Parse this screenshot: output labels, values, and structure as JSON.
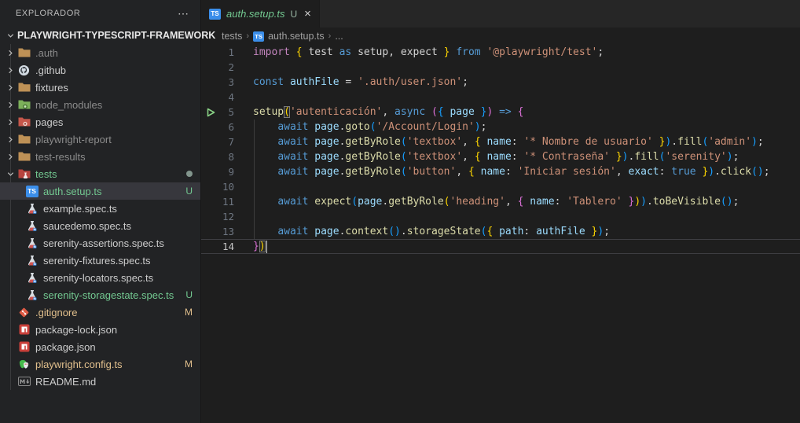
{
  "colors": {
    "accent_green_untracked": "#73c991",
    "accent_tan_modified": "#e2c08d",
    "ts_icon_blue": "#3b8eea",
    "folder_tan": "#be9156",
    "folder_node_green": "#7cb05a",
    "folder_pages_red": "#c6574b",
    "folder_tests_red": "#b7443e",
    "npm_red": "#cb3837",
    "git_orange": "#de4c36",
    "bracket_gold": "#ffd700",
    "bracket_pink": "#da70d6",
    "bracket_blue": "#179fff",
    "string_orange": "#ce9178",
    "keyword_blue": "#569cd6",
    "keyword_pink": "#c586c0",
    "function_yellow": "#dcdcaa",
    "identifier_blue": "#9cdcfe"
  },
  "sidebar": {
    "title": "EXPLORADOR",
    "more_actions": "⋯",
    "root": {
      "label": "PLAYWRIGHT-TYPESCRIPT-FRAMEWORK",
      "chevron": "down"
    },
    "items": [
      {
        "label": ".auth",
        "icon": "folder",
        "chevron": "right",
        "dim": true,
        "indent": 1
      },
      {
        "label": ".github",
        "icon": "github",
        "chevron": "right",
        "indent": 1
      },
      {
        "label": "fixtures",
        "icon": "folder",
        "chevron": "right",
        "indent": 1
      },
      {
        "label": "node_modules",
        "icon": "folder-node",
        "chevron": "right",
        "dim": true,
        "indent": 1
      },
      {
        "label": "pages",
        "icon": "folder-pages",
        "chevron": "right",
        "indent": 1
      },
      {
        "label": "playwright-report",
        "icon": "folder",
        "chevron": "right",
        "dim": true,
        "indent": 1
      },
      {
        "label": "test-results",
        "icon": "folder",
        "chevron": "right",
        "dim": true,
        "indent": 1
      },
      {
        "label": "tests",
        "icon": "folder-tests",
        "chevron": "down",
        "color": "green",
        "badge": "dot",
        "indent": 1
      },
      {
        "label": "auth.setup.ts",
        "icon": "ts",
        "indent": 2,
        "selected": true,
        "color": "green",
        "badge": "U"
      },
      {
        "label": "example.spec.ts",
        "icon": "flask",
        "indent": 2
      },
      {
        "label": "saucedemo.spec.ts",
        "icon": "flask",
        "indent": 2
      },
      {
        "label": "serenity-assertions.spec.ts",
        "icon": "flask",
        "indent": 2
      },
      {
        "label": "serenity-fixtures.spec.ts",
        "icon": "flask",
        "indent": 2
      },
      {
        "label": "serenity-locators.spec.ts",
        "icon": "flask",
        "indent": 2
      },
      {
        "label": "serenity-storagestate.spec.ts",
        "icon": "flask",
        "indent": 2,
        "color": "green",
        "badge": "U"
      },
      {
        "label": ".gitignore",
        "icon": "git",
        "indent": 1,
        "file": true,
        "color": "mod",
        "badge": "M"
      },
      {
        "label": "package-lock.json",
        "icon": "npm",
        "indent": 1,
        "file": true
      },
      {
        "label": "package.json",
        "icon": "npm",
        "indent": 1,
        "file": true
      },
      {
        "label": "playwright.config.ts",
        "icon": "playwright",
        "indent": 1,
        "file": true,
        "color": "mod",
        "badge": "M"
      },
      {
        "label": "README.md",
        "icon": "markdown",
        "indent": 1,
        "file": true
      }
    ]
  },
  "tabbar": {
    "tab": {
      "label": "auth.setup.ts",
      "badge": "U",
      "close": "×",
      "modified_state": "untracked",
      "preview_italic": true
    }
  },
  "breadcrumbs": {
    "items": [
      "tests",
      "auth.setup.ts",
      "..."
    ]
  },
  "editor": {
    "language": "typescript",
    "current_line": 14,
    "lines": [
      {
        "n": 1,
        "tokens": [
          [
            "import",
            "kp"
          ],
          [
            " ",
            "pl"
          ],
          [
            "{",
            "b1"
          ],
          [
            " ",
            "pl"
          ],
          [
            "test",
            "pl"
          ],
          [
            " ",
            "pl"
          ],
          [
            "as",
            "kb"
          ],
          [
            " ",
            "pl"
          ],
          [
            "setup",
            "pl"
          ],
          [
            ", ",
            "pl"
          ],
          [
            "expect",
            "pl"
          ],
          [
            " ",
            "pl"
          ],
          [
            "}",
            "b1"
          ],
          [
            " ",
            "pl"
          ],
          [
            "from",
            "kb"
          ],
          [
            " ",
            "pl"
          ],
          [
            "'@playwright/test'",
            "st"
          ],
          [
            ";",
            "pl"
          ]
        ]
      },
      {
        "n": 2,
        "tokens": []
      },
      {
        "n": 3,
        "tokens": [
          [
            "const",
            "kb"
          ],
          [
            " ",
            "pl"
          ],
          [
            "authFile",
            "id"
          ],
          [
            " = ",
            "pl"
          ],
          [
            "'.auth/user.json'",
            "st"
          ],
          [
            ";",
            "pl"
          ]
        ]
      },
      {
        "n": 4,
        "tokens": []
      },
      {
        "n": 5,
        "play": true,
        "tokens": [
          [
            "setup",
            "fn"
          ],
          [
            "(",
            "b1",
            "box"
          ],
          [
            "'autenticación'",
            "st"
          ],
          [
            ", ",
            "pl"
          ],
          [
            "async",
            "kb"
          ],
          [
            " ",
            "pl"
          ],
          [
            "(",
            "b2"
          ],
          [
            "{",
            "b3"
          ],
          [
            " ",
            "pl"
          ],
          [
            "page",
            "id"
          ],
          [
            " ",
            "pl"
          ],
          [
            "}",
            "b3"
          ],
          [
            ")",
            "b2"
          ],
          [
            " ",
            "pl"
          ],
          [
            "=>",
            "kb"
          ],
          [
            " ",
            "pl"
          ],
          [
            "{",
            "b2"
          ]
        ]
      },
      {
        "n": 6,
        "guide": true,
        "tokens": [
          [
            "    ",
            "pl"
          ],
          [
            "await",
            "kb"
          ],
          [
            " ",
            "pl"
          ],
          [
            "page",
            "id"
          ],
          [
            ".",
            "pl"
          ],
          [
            "goto",
            "fn"
          ],
          [
            "(",
            "b3"
          ],
          [
            "'/Account/Login'",
            "st"
          ],
          [
            ")",
            "b3"
          ],
          [
            ";",
            "pl"
          ]
        ]
      },
      {
        "n": 7,
        "guide": true,
        "tokens": [
          [
            "    ",
            "pl"
          ],
          [
            "await",
            "kb"
          ],
          [
            " ",
            "pl"
          ],
          [
            "page",
            "id"
          ],
          [
            ".",
            "pl"
          ],
          [
            "getByRole",
            "fn"
          ],
          [
            "(",
            "b3"
          ],
          [
            "'textbox'",
            "st"
          ],
          [
            ", ",
            "pl"
          ],
          [
            "{",
            "b1"
          ],
          [
            " ",
            "pl"
          ],
          [
            "name",
            "id"
          ],
          [
            ": ",
            "pl"
          ],
          [
            "'* Nombre de usuario'",
            "st"
          ],
          [
            " ",
            "pl"
          ],
          [
            "}",
            "b1"
          ],
          [
            ")",
            "b3"
          ],
          [
            ".",
            "pl"
          ],
          [
            "fill",
            "fn"
          ],
          [
            "(",
            "b3"
          ],
          [
            "'admin'",
            "st"
          ],
          [
            ")",
            "b3"
          ],
          [
            ";",
            "pl"
          ]
        ]
      },
      {
        "n": 8,
        "guide": true,
        "tokens": [
          [
            "    ",
            "pl"
          ],
          [
            "await",
            "kb"
          ],
          [
            " ",
            "pl"
          ],
          [
            "page",
            "id"
          ],
          [
            ".",
            "pl"
          ],
          [
            "getByRole",
            "fn"
          ],
          [
            "(",
            "b3"
          ],
          [
            "'textbox'",
            "st"
          ],
          [
            ", ",
            "pl"
          ],
          [
            "{",
            "b1"
          ],
          [
            " ",
            "pl"
          ],
          [
            "name",
            "id"
          ],
          [
            ": ",
            "pl"
          ],
          [
            "'* Contraseña'",
            "st"
          ],
          [
            " ",
            "pl"
          ],
          [
            "}",
            "b1"
          ],
          [
            ")",
            "b3"
          ],
          [
            ".",
            "pl"
          ],
          [
            "fill",
            "fn"
          ],
          [
            "(",
            "b3"
          ],
          [
            "'serenity'",
            "st"
          ],
          [
            ")",
            "b3"
          ],
          [
            ";",
            "pl"
          ]
        ]
      },
      {
        "n": 9,
        "guide": true,
        "tokens": [
          [
            "    ",
            "pl"
          ],
          [
            "await",
            "kb"
          ],
          [
            " ",
            "pl"
          ],
          [
            "page",
            "id"
          ],
          [
            ".",
            "pl"
          ],
          [
            "getByRole",
            "fn"
          ],
          [
            "(",
            "b3"
          ],
          [
            "'button'",
            "st"
          ],
          [
            ", ",
            "pl"
          ],
          [
            "{",
            "b1"
          ],
          [
            " ",
            "pl"
          ],
          [
            "name",
            "id"
          ],
          [
            ": ",
            "pl"
          ],
          [
            "'Iniciar sesión'",
            "st"
          ],
          [
            ", ",
            "pl"
          ],
          [
            "exact",
            "id"
          ],
          [
            ": ",
            "pl"
          ],
          [
            "true",
            "kb"
          ],
          [
            " ",
            "pl"
          ],
          [
            "}",
            "b1"
          ],
          [
            ")",
            "b3"
          ],
          [
            ".",
            "pl"
          ],
          [
            "click",
            "fn"
          ],
          [
            "(",
            "b3"
          ],
          [
            ")",
            "b3"
          ],
          [
            ";",
            "pl"
          ]
        ]
      },
      {
        "n": 10,
        "guide": true,
        "tokens": []
      },
      {
        "n": 11,
        "guide": true,
        "tokens": [
          [
            "    ",
            "pl"
          ],
          [
            "await",
            "kb"
          ],
          [
            " ",
            "pl"
          ],
          [
            "expect",
            "fn"
          ],
          [
            "(",
            "b3"
          ],
          [
            "page",
            "id"
          ],
          [
            ".",
            "pl"
          ],
          [
            "getByRole",
            "fn"
          ],
          [
            "(",
            "b1"
          ],
          [
            "'heading'",
            "st"
          ],
          [
            ", ",
            "pl"
          ],
          [
            "{",
            "b2"
          ],
          [
            " ",
            "pl"
          ],
          [
            "name",
            "id"
          ],
          [
            ": ",
            "pl"
          ],
          [
            "'Tablero'",
            "st"
          ],
          [
            " ",
            "pl"
          ],
          [
            "}",
            "b2"
          ],
          [
            ")",
            "b1"
          ],
          [
            ")",
            "b3"
          ],
          [
            ".",
            "pl"
          ],
          [
            "toBeVisible",
            "fn"
          ],
          [
            "(",
            "b3"
          ],
          [
            ")",
            "b3"
          ],
          [
            ";",
            "pl"
          ]
        ]
      },
      {
        "n": 12,
        "guide": true,
        "tokens": []
      },
      {
        "n": 13,
        "guide": true,
        "tokens": [
          [
            "    ",
            "pl"
          ],
          [
            "await",
            "kb"
          ],
          [
            " ",
            "pl"
          ],
          [
            "page",
            "id"
          ],
          [
            ".",
            "pl"
          ],
          [
            "context",
            "fn"
          ],
          [
            "(",
            "b3"
          ],
          [
            ")",
            "b3"
          ],
          [
            ".",
            "pl"
          ],
          [
            "storageState",
            "fn"
          ],
          [
            "(",
            "b3"
          ],
          [
            "{",
            "b1"
          ],
          [
            " ",
            "pl"
          ],
          [
            "path",
            "id"
          ],
          [
            ": ",
            "pl"
          ],
          [
            "authFile",
            "id"
          ],
          [
            " ",
            "pl"
          ],
          [
            "}",
            "b1"
          ],
          [
            ")",
            "b3"
          ],
          [
            ";",
            "pl"
          ]
        ]
      },
      {
        "n": 14,
        "current": true,
        "cursor": true,
        "tokens": [
          [
            "}",
            "b2"
          ],
          [
            ")",
            "b1",
            "box"
          ]
        ]
      }
    ]
  }
}
